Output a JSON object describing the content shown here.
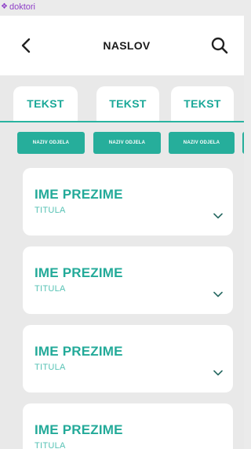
{
  "frame": {
    "label": "doktori",
    "label_color": "#8e3fc7"
  },
  "header": {
    "title": "NASLOV",
    "back_icon": "chevron-left-icon",
    "search_icon": "search-icon"
  },
  "tabs": [
    {
      "label": "TEKST"
    },
    {
      "label": "TEKST"
    },
    {
      "label": "TEKST"
    }
  ],
  "chips": [
    {
      "label": "NAZIV ODJELA"
    },
    {
      "label": "NAZIV ODJELA"
    },
    {
      "label": "NAZIV ODJELA"
    }
  ],
  "doctors": [
    {
      "name": "IME PREZIME",
      "title": "TITULA"
    },
    {
      "name": "IME PREZIME",
      "title": "TITULA"
    },
    {
      "name": "IME PREZIME",
      "title": "TITULA"
    },
    {
      "name": "IME PREZIME",
      "title": "TITULA"
    }
  ],
  "colors": {
    "accent": "#26ae9b",
    "background": "#e9e9e9",
    "card": "#ffffff"
  }
}
